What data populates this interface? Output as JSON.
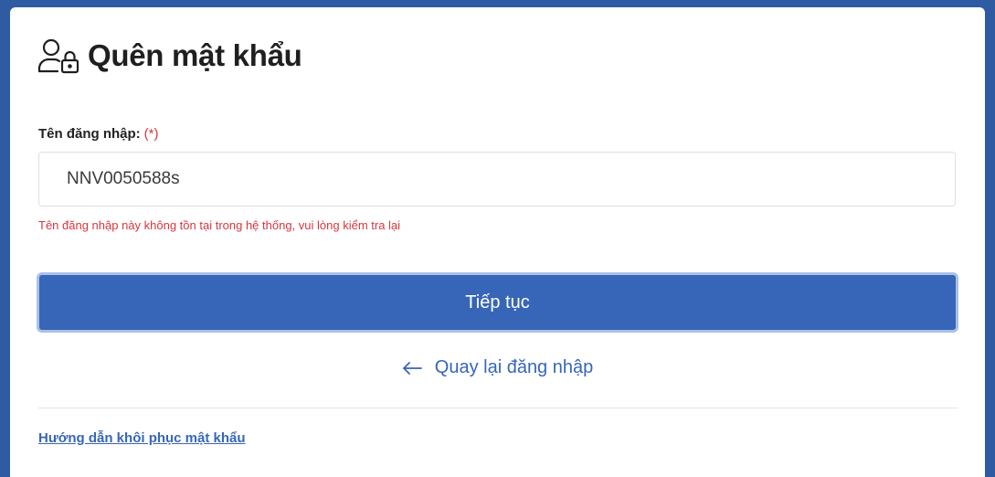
{
  "page": {
    "title": "Quên mật khẩu",
    "title_icon": "user-lock-icon"
  },
  "form": {
    "username_label": "Tên đăng nhập:",
    "required_mark": "(*)",
    "username_value": "NNV0050588s",
    "error_message": "Tên đăng nhập này không tồn tại trong hệ thống, vui lòng kiểm tra lại",
    "submit_label": "Tiếp tục"
  },
  "links": {
    "back_label": "Quay lại đăng nhập",
    "back_icon": "arrow-left-icon",
    "help_label": "Hướng dẫn khôi phục mật khẩu"
  },
  "colors": {
    "background": "#2f5ba3",
    "primary": "#3766b8",
    "error": "#d9363e"
  }
}
